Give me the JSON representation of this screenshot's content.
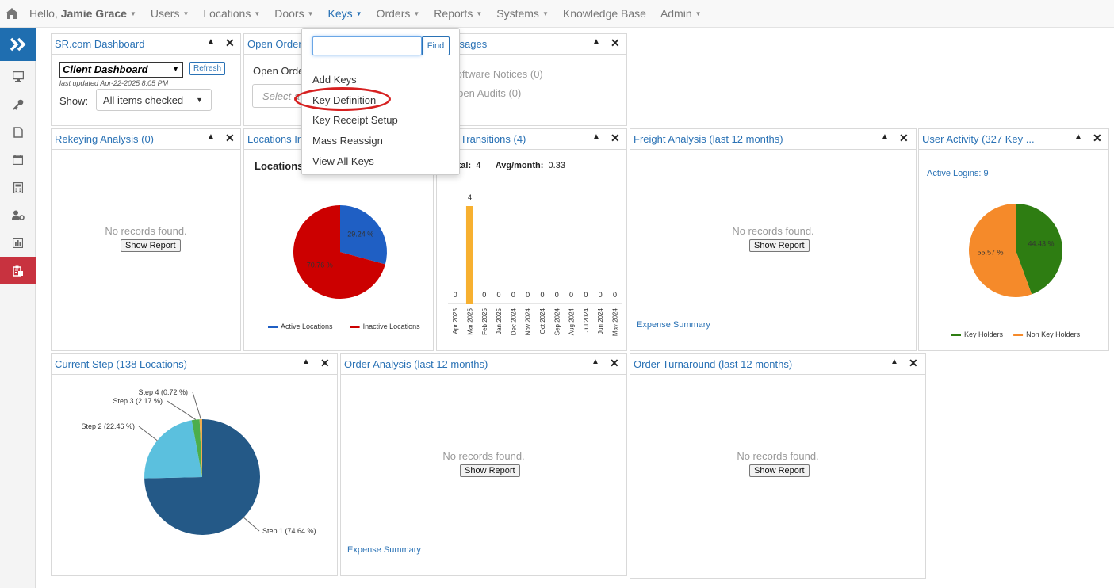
{
  "nav": {
    "hello_prefix": "Hello,",
    "user_name": "Jamie Grace",
    "items": [
      {
        "label": "Users",
        "caret": true
      },
      {
        "label": "Locations",
        "caret": true
      },
      {
        "label": "Doors",
        "caret": true
      },
      {
        "label": "Keys",
        "caret": true,
        "active": true
      },
      {
        "label": "Orders",
        "caret": true
      },
      {
        "label": "Reports",
        "caret": true
      },
      {
        "label": "Systems",
        "caret": true
      },
      {
        "label": "Knowledge Base",
        "caret": false
      },
      {
        "label": "Admin",
        "caret": true
      }
    ]
  },
  "keys_menu": {
    "search_value": "",
    "find_label": "Find",
    "items": [
      "Add Keys",
      "Key Definition",
      "Key Receipt Setup",
      "Mass Reassign",
      "View All Keys"
    ]
  },
  "panels": {
    "dashboard": {
      "title": "SR.com Dashboard",
      "selected": "Client Dashboard",
      "refresh": "Refresh",
      "updated": "last updated Apr-22-2025 8:05 PM",
      "show_label": "Show:",
      "show_value": "All items checked"
    },
    "open_orders": {
      "title": "Open Orders",
      "text": "Open Orde",
      "select_placeholder": "Select a"
    },
    "messages": {
      "title": "Messages",
      "items": [
        "Software Notices (0)",
        "Open Audits (0)"
      ]
    },
    "rekeying": {
      "title": "Rekeying Analysis (0)",
      "empty": "No records found.",
      "button": "Show Report"
    },
    "locations": {
      "title": "Locations Info",
      "chart_title": "Locations"
    },
    "transitions": {
      "title": "Key Transitions (4)",
      "total_label": "Total:",
      "total_value": "4",
      "avg_label": "Avg/month:",
      "avg_value": "0.33"
    },
    "freight": {
      "title": "Freight Analysis (last 12 months)",
      "empty": "No records found.",
      "button": "Show Report",
      "link": "Expense Summary"
    },
    "user_activity": {
      "title": "User Activity (327 Key ...",
      "active_logins": "Active Logins: 9"
    },
    "current_step": {
      "title": "Current Step (138 Locations)"
    },
    "order_analysis": {
      "title": "Order Analysis (last 12 months)",
      "empty": "No records found.",
      "button": "Show Report",
      "link": "Expense Summary"
    },
    "order_turnaround": {
      "title": "Order Turnaround (last 12 months)",
      "empty": "No records found.",
      "button": "Show Report"
    }
  },
  "chart_data": [
    {
      "type": "pie",
      "title": "Locations",
      "slices": [
        {
          "name": "Active Locations",
          "value": 29.24,
          "label": "29.24 %",
          "color": "#1f5fc4"
        },
        {
          "name": "Inactive Locations",
          "value": 70.76,
          "label": "70.76 %",
          "color": "#cc0000"
        }
      ]
    },
    {
      "type": "bar",
      "categories": [
        "Apr 2025",
        "Mar 2025",
        "Feb 2025",
        "Jan 2025",
        "Dec 2024",
        "Nov 2024",
        "Oct 2024",
        "Sep 2024",
        "Aug 2024",
        "Jul 2024",
        "Jun 2024",
        "May 2024"
      ],
      "values": [
        0,
        4,
        0,
        0,
        0,
        0,
        0,
        0,
        0,
        0,
        0,
        0
      ],
      "color": "#f7b030",
      "ylim": [
        0,
        4
      ]
    },
    {
      "type": "pie",
      "slices": [
        {
          "name": "Key Holders",
          "value": 44.43,
          "label": "44.43 %",
          "color": "#2e7d12"
        },
        {
          "name": "Non Key Holders",
          "value": 55.57,
          "label": "55.57 %",
          "color": "#f58a2a"
        }
      ]
    },
    {
      "type": "pie",
      "slices": [
        {
          "name": "Step 1",
          "value": 74.64,
          "label": "Step 1 (74.64 %)",
          "color": "#245987"
        },
        {
          "name": "Step 2",
          "value": 22.46,
          "label": "Step 2 (22.46 %)",
          "color": "#5bc0de"
        },
        {
          "name": "Step 3",
          "value": 2.17,
          "label": "Step 3 (2.17 %)",
          "color": "#4cae4c"
        },
        {
          "name": "Step 4",
          "value": 0.72,
          "label": "Step 4 (0.72 %)",
          "color": "#f0ad4e"
        }
      ]
    }
  ]
}
